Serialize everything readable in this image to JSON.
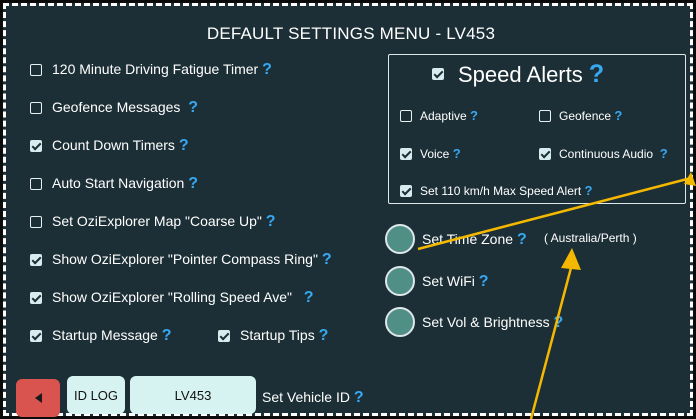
{
  "title": "DEFAULT SETTINGS MENU - LV453",
  "help_glyph": "?",
  "left_options": [
    {
      "label": "120 Minute Driving Fatigue Timer",
      "checked": false
    },
    {
      "label": "Geofence Messages",
      "checked": false
    },
    {
      "label": "Count Down Timers",
      "checked": true
    },
    {
      "label": "Auto Start Navigation",
      "checked": false
    },
    {
      "label": "Set OziExplorer Map \"Coarse Up\"",
      "checked": false
    },
    {
      "label": "Show OziExplorer \"Pointer Compass Ring\"",
      "checked": true
    },
    {
      "label": "Show OziExplorer \"Rolling Speed Ave\"",
      "checked": true
    },
    {
      "label": "Startup Message",
      "checked": true
    },
    {
      "label": "Startup Tips",
      "checked": true
    }
  ],
  "speed_alerts": {
    "heading": "Speed Alerts",
    "enabled": true,
    "options": [
      {
        "label": "Adaptive",
        "checked": false
      },
      {
        "label": "Geofence",
        "checked": false
      },
      {
        "label": "Voice",
        "checked": true
      },
      {
        "label": "Continuous Audio",
        "checked": true
      },
      {
        "label": "Set 110 km/h Max Speed Alert",
        "checked": true
      }
    ]
  },
  "round_buttons": [
    {
      "label": "Set Time Zone",
      "value": "( Australia/Perth )"
    },
    {
      "label": "Set WiFi"
    },
    {
      "label": "Set Vol & Brightness"
    }
  ],
  "bottom_bar": {
    "id_log_label": "ID LOG",
    "vehicle_id": "LV453",
    "set_vehicle_label": "Set Vehicle ID"
  },
  "colors": {
    "background": "#1c2f36",
    "help_icon": "#37a8f2",
    "arrow": "#f5b800",
    "round_button": "#4f8f86",
    "back_button": "#d9534f",
    "pill_button": "#d7f3f1"
  }
}
